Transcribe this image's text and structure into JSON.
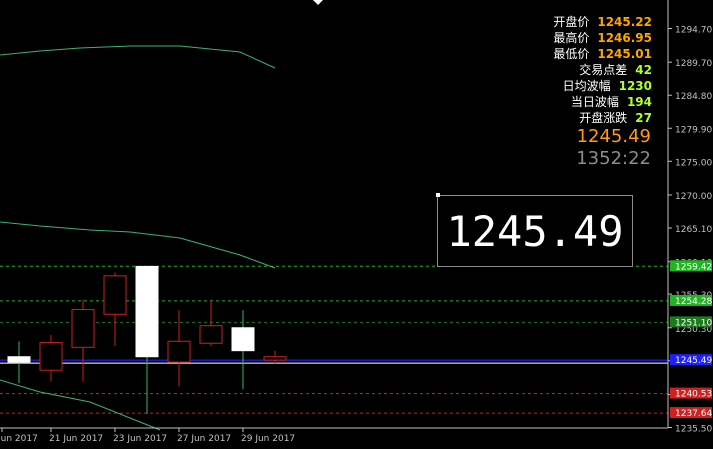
{
  "info_panel": {
    "rows": [
      {
        "label": "开盘价",
        "value": "1245.22",
        "color": "orange"
      },
      {
        "label": "最高价",
        "value": "1246.95",
        "color": "orange"
      },
      {
        "label": "最低价",
        "value": "1245.01",
        "color": "orange"
      },
      {
        "label": "交易点差",
        "value": "42",
        "color": "green"
      },
      {
        "label": "日均波幅",
        "value": "1230",
        "color": "green"
      },
      {
        "label": "当日波幅",
        "value": "194",
        "color": "green"
      },
      {
        "label": "开盘涨跌",
        "value": "27",
        "color": "green"
      }
    ],
    "current_price": "1245.49",
    "countdown": "1352:22"
  },
  "price_box": {
    "value": "1245.49"
  },
  "chart_data": {
    "type": "candlestick",
    "price_axis": {
      "range": [
        1234.0,
        1298.2
      ],
      "ticks": [
        "1294.70",
        "1289.70",
        "1284.80",
        "1279.90",
        "1275.00",
        "1270.00",
        "1265.10",
        "1260.10",
        "1255.30",
        "1250.30",
        "1245.40",
        "1240.40",
        "1235.50"
      ]
    },
    "x_axis": {
      "labels": [
        "Jun 2017",
        "21 Jun 2017",
        "23 Jun 2017",
        "27 Jun 2017",
        "29 Jun 2017"
      ]
    },
    "candles": [
      {
        "open": 1246.0,
        "high": 1248.3,
        "low": 1242.1,
        "close": 1245.2,
        "color": "white"
      },
      {
        "open": 1244.0,
        "high": 1249.2,
        "low": 1242.3,
        "close": 1248.1,
        "color": "red"
      },
      {
        "open": 1247.4,
        "high": 1254.5,
        "low": 1242.3,
        "close": 1253.0,
        "color": "red"
      },
      {
        "open": 1252.3,
        "high": 1258.5,
        "low": 1247.6,
        "close": 1258.0,
        "color": "red"
      },
      {
        "open": 1259.4,
        "high": 1259.4,
        "low": 1237.5,
        "close": 1246.0,
        "color": "white"
      },
      {
        "open": 1245.2,
        "high": 1252.9,
        "low": 1241.6,
        "close": 1248.3,
        "color": "red"
      },
      {
        "open": 1248.0,
        "high": 1254.5,
        "low": 1247.6,
        "close": 1250.6,
        "color": "red"
      },
      {
        "open": 1250.3,
        "high": 1252.9,
        "low": 1241.2,
        "close": 1246.9,
        "color": "white"
      },
      {
        "open": 1246.0,
        "high": 1246.9,
        "low": 1245.0,
        "close": 1245.5,
        "color": "red"
      }
    ],
    "levels": [
      {
        "price": "1259.42",
        "color": "#22b522",
        "style": "dashed"
      },
      {
        "price": "1254.28",
        "color": "#22b522",
        "style": "dashed"
      },
      {
        "price": "1251.10",
        "color": "#1d7a1d",
        "style": "dashed"
      },
      {
        "price": "1245.49",
        "color": "#2020ff",
        "style": "solid"
      },
      {
        "price": "1240.53",
        "color": "#d02020",
        "style": "dashed"
      },
      {
        "price": "1237.64",
        "color": "#d02020",
        "style": "dashed"
      }
    ]
  }
}
